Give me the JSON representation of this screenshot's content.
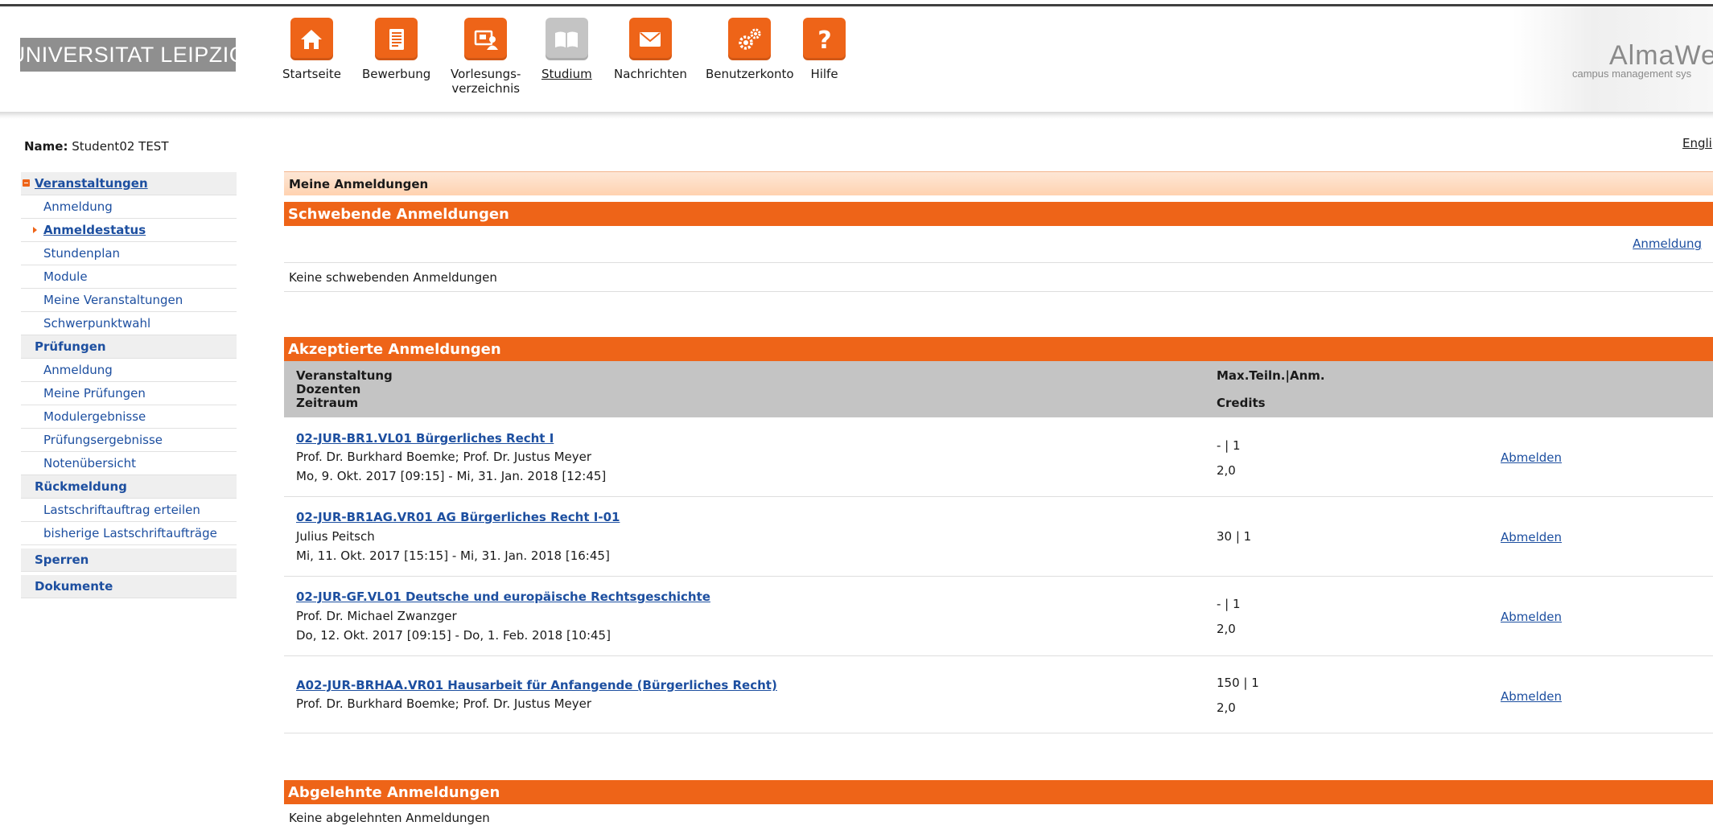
{
  "header": {
    "university": "UNIVERSITAT LEIPZIG",
    "brand_title": "AlmaWe",
    "brand_subtitle": "campus management sys",
    "nav": [
      {
        "label": "Startseite",
        "icon": "home-icon",
        "active": false
      },
      {
        "label": "Bewerbung",
        "icon": "application-icon",
        "active": false
      },
      {
        "label_line1": "Vorlesungs-",
        "label_line2": "verzeichnis",
        "icon": "course-catalog-icon",
        "active": false
      },
      {
        "label": "Studium",
        "icon": "book-icon",
        "active": true
      },
      {
        "label": "Nachrichten",
        "icon": "mail-icon",
        "active": false
      },
      {
        "label": "Benutzerkonto",
        "icon": "gears-icon",
        "active": false
      },
      {
        "label": "Hilfe",
        "icon": "help-icon",
        "active": false
      }
    ]
  },
  "user": {
    "name_label": "Name:",
    "name_value": "Student02 TEST"
  },
  "language_link": "Engli",
  "sidebar": {
    "groups": [
      {
        "label": "Veranstaltungen",
        "items": [
          "Anmeldung",
          "Anmeldestatus",
          "Stundenplan",
          "Module",
          "Meine Veranstaltungen",
          "Schwerpunktwahl"
        ]
      },
      {
        "label": "Prüfungen",
        "items": [
          "Anmeldung",
          "Meine Prüfungen",
          "Modulergebnisse",
          "Prüfungsergebnisse",
          "Notenübersicht"
        ]
      },
      {
        "label": "Rückmeldung",
        "items": [
          "Lastschriftauftrag erteilen",
          "bisherige Lastschriftaufträge"
        ]
      },
      {
        "label": "Sperren",
        "items": []
      },
      {
        "label": "Dokumente",
        "items": []
      }
    ]
  },
  "main": {
    "page_title": "Meine Anmeldungen",
    "pending": {
      "title": "Schwebende Anmeldungen",
      "link": "Anmeldung",
      "empty_msg": "Keine schwebenden Anmeldungen"
    },
    "accepted": {
      "title": "Akzeptierte Anmeldungen",
      "headers": {
        "col1_line1": "Veranstaltung",
        "col1_line2": "Dozenten",
        "col1_line3": "Zeitraum",
        "col2_line1": "Max.Teiln.|Anm.",
        "col2_line2": "Credits"
      },
      "rows": [
        {
          "course": "02-JUR-BR1.VL01 Bürgerliches Recht I",
          "lecturers": "Prof. Dr. Burkhard Boemke; Prof. Dr. Justus Meyer",
          "period": "Mo, 9. Okt. 2017 [09:15] - Mi, 31. Jan. 2018 [12:45]",
          "max_anm": "- | 1",
          "credits": "2,0",
          "action": "Abmelden"
        },
        {
          "course": "02-JUR-BR1AG.VR01 AG Bürgerliches Recht I-01",
          "lecturers": "Julius Peitsch",
          "period": "Mi, 11. Okt. 2017 [15:15] - Mi, 31. Jan. 2018 [16:45]",
          "max_anm": "30 | 1",
          "credits": "",
          "action": "Abmelden"
        },
        {
          "course": "02-JUR-GF.VL01 Deutsche und europäische Rechtsgeschichte",
          "lecturers": "Prof. Dr. Michael Zwanzger",
          "period": "Do, 12. Okt. 2017 [09:15] - Do, 1. Feb. 2018 [10:45]",
          "max_anm": "- | 1",
          "credits": "2,0",
          "action": "Abmelden"
        },
        {
          "course": "A02-JUR-BRHAA.VR01 Hausarbeit für Anfangende (Bürgerliches Recht)",
          "lecturers": "Prof. Dr. Burkhard Boemke; Prof. Dr. Justus Meyer",
          "period": "",
          "max_anm": "150 | 1",
          "credits": "2,0",
          "action": "Abmelden"
        }
      ]
    },
    "rejected": {
      "title": "Abgelehnte Anmeldungen",
      "empty_msg": "Keine abgelehnten Anmeldungen"
    }
  },
  "colors": {
    "accent": "#ee6418",
    "link": "#1d4fa0",
    "table_header": "#c4c4c4"
  }
}
